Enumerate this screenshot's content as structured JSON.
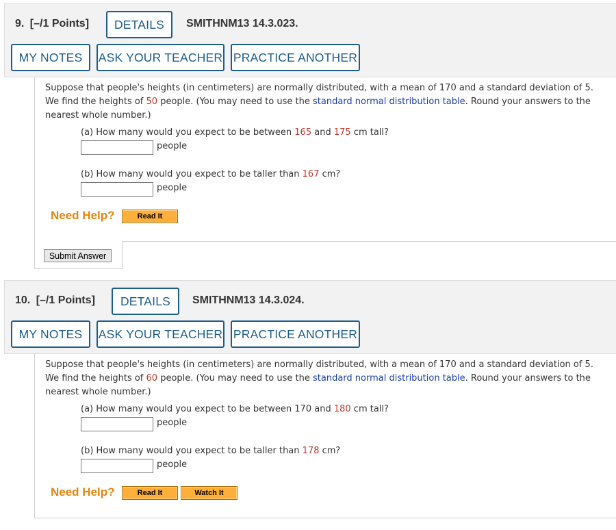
{
  "questions": [
    {
      "number": "9.",
      "points": "[–/1 Points]",
      "details_label": "DETAILS",
      "code": "SMITHNM13 14.3.023.",
      "my_notes_label": "MY NOTES",
      "ask_teacher_label": "ASK YOUR TEACHER",
      "practice_label": "PRACTICE ANOTHER",
      "text": {
        "t1": "Suppose that people's heights (in centimeters) are normally distributed, with a mean of 170 and a standard deviation of 5.",
        "t2": "We find the heights of ",
        "n": "50",
        "t3": " people. (You may need to use the ",
        "link": "standard normal distribution table",
        "t4": ". Round your answers to the",
        "t5": "nearest whole number.)"
      },
      "part_a": {
        "prefix": "(a) How many would you expect to be between ",
        "v1": "165",
        "mid": " and ",
        "v2": "175",
        "suffix": " cm tall?",
        "value": "",
        "unit": "people"
      },
      "part_b": {
        "prefix": "(b) How many would you expect to be taller than ",
        "v1": "167",
        "suffix": " cm?",
        "value": "",
        "unit": "people"
      },
      "need_help": "Need Help?",
      "help_buttons": [
        "Read It"
      ],
      "submit_label": "Submit Answer"
    },
    {
      "number": "10.",
      "points": "[–/1 Points]",
      "details_label": "DETAILS",
      "code": "SMITHNM13 14.3.024.",
      "my_notes_label": "MY NOTES",
      "ask_teacher_label": "ASK YOUR TEACHER",
      "practice_label": "PRACTICE ANOTHER",
      "text": {
        "t1": "Suppose that people's heights (in centimeters) are normally distributed, with a mean of 170 and a standard deviation of 5.",
        "t2": "We find the heights of ",
        "n": "60",
        "t3": " people. (You may need to use the ",
        "link": "standard normal distribution table",
        "t4": ". Round your answers to the",
        "t5": "nearest whole number.)"
      },
      "part_a": {
        "prefix": "(a) How many would you expect to be between ",
        "v1": "170",
        "mid": " and ",
        "v2": "180",
        "suffix": " cm tall?",
        "value": "",
        "unit": "people"
      },
      "part_b": {
        "prefix": "(b) How many would you expect to be taller than ",
        "v1": "178",
        "suffix": " cm?",
        "value": "",
        "unit": "people"
      },
      "need_help": "Need Help?",
      "help_buttons": [
        "Read It",
        "Watch It"
      ]
    }
  ],
  "colors": {
    "header_bg": "#f2f2f2",
    "button_blue": "#1c5d8c",
    "value_red": "#c0392b",
    "link_blue": "#1a3ea8",
    "need_help_orange": "#e8840c",
    "help_button_orange": "#fdae3b"
  }
}
